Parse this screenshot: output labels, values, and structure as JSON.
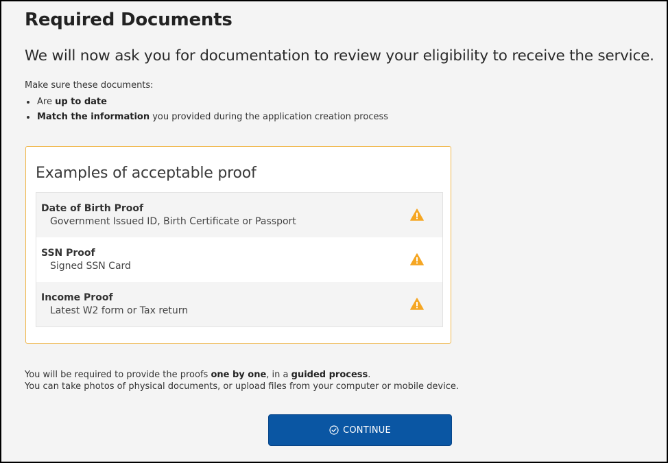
{
  "page": {
    "title": "Required Documents",
    "subtitle": "We will now ask you for documentation to review your eligibility to receive the service."
  },
  "intro": {
    "lead": "Make sure these documents:",
    "items": [
      {
        "prefix": "Are ",
        "bold": "up to date",
        "suffix": ""
      },
      {
        "prefix": "",
        "bold": "Match the information",
        "suffix": " you provided during the application creation process"
      }
    ]
  },
  "proofs": {
    "title": "Examples of acceptable proof",
    "items": [
      {
        "title": "Date of Birth Proof",
        "description": "Government Issued ID, Birth Certificate or Passport",
        "status_icon": "warning-icon"
      },
      {
        "title": "SSN Proof",
        "description": "Signed SSN Card",
        "status_icon": "warning-icon"
      },
      {
        "title": "Income Proof",
        "description": "Latest W2 form or Tax return",
        "status_icon": "warning-icon"
      }
    ]
  },
  "footer": {
    "line1": {
      "a": "You will be required to provide the proofs ",
      "b": "one by one",
      "c": ", in a ",
      "d": "guided process",
      "e": "."
    },
    "line2": "You can take photos of physical documents, or upload files from your computer or mobile device."
  },
  "actions": {
    "continue_label": "CONTINUE",
    "continue_icon": "check-circle-icon"
  },
  "colors": {
    "accent": "#0a56a3",
    "card_border": "#f0b64a",
    "warning": "#f5a623"
  }
}
